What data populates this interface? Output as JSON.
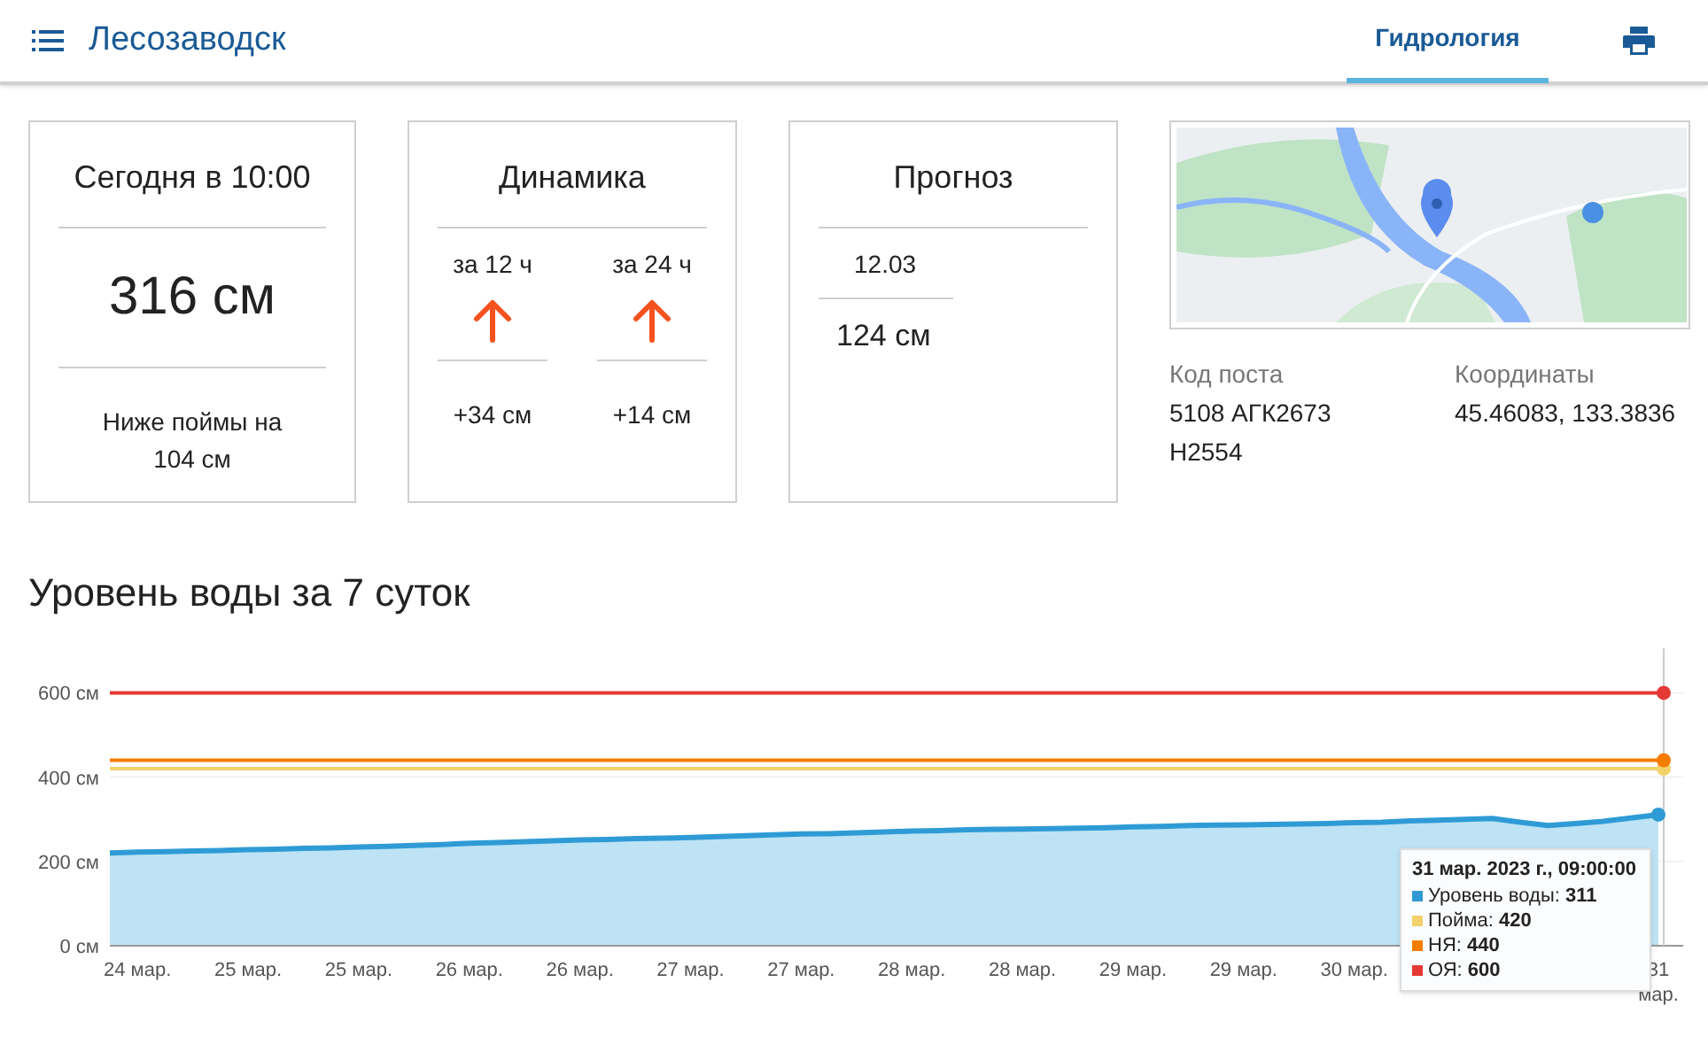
{
  "header": {
    "title": "Лесозаводск",
    "tabs": [
      {
        "label": "Гидрология",
        "selected": true
      }
    ]
  },
  "cards": [
    {
      "kind": "current",
      "title": "Сегодня в 10:00",
      "value": "316 см",
      "note": "Ниже поймы на 104 см"
    },
    {
      "kind": "dynamics",
      "title": "Динамика",
      "columns": [
        {
          "period": "за 12 ч",
          "rising": true,
          "change": "+34 см"
        },
        {
          "period": "за 24 ч",
          "rising": true,
          "change": "+14 см"
        }
      ]
    },
    {
      "kind": "forecast",
      "title": "Прогноз",
      "date": "12.03",
      "value": "124 см"
    }
  ],
  "post": {
    "code_label": "Код поста",
    "code_value": "5108 АГК2673 Н2554",
    "coords_label": "Координаты",
    "coords_value": "45.46083, 133.3836"
  },
  "chart_title": "Уровень воды за 7 суток",
  "chart": {
    "chart_data": {
      "type": "area",
      "categories": [
        null,
        "24 мар.",
        null,
        null,
        null,
        "25 мар.",
        null,
        null,
        null,
        "25 мар.",
        null,
        null,
        null,
        "26 мар.",
        null,
        null,
        null,
        "26 мар.",
        null,
        null,
        null,
        "27 мар.",
        null,
        null,
        null,
        "27 мар.",
        null,
        null,
        null,
        "28 мар.",
        null,
        null,
        null,
        "28 мар.",
        null,
        null,
        null,
        "29 мар.",
        null,
        null,
        null,
        "29 мар.",
        null,
        null,
        null,
        "30 мар.",
        null,
        null,
        null,
        null,
        null,
        null,
        null,
        null,
        null,
        null,
        "31 мар."
      ],
      "series": [
        {
          "color": "#2f9bd6",
          "values": [
            220,
            222,
            223,
            225,
            226,
            228,
            229,
            231,
            232,
            234,
            236,
            238,
            240,
            243,
            245,
            247,
            249,
            251,
            252,
            254,
            255,
            257,
            259,
            261,
            263,
            265,
            266,
            268,
            270,
            272,
            273,
            275,
            276,
            277,
            278,
            279,
            280,
            282,
            283,
            285,
            286,
            287,
            288,
            289,
            290,
            292,
            293,
            296,
            298,
            300,
            302,
            293,
            285,
            290,
            295,
            303,
            311
          ]
        },
        {
          "type": "line",
          "color": "#f2d16b",
          "values": [
            420,
            420,
            420,
            420,
            420,
            420,
            420,
            420,
            420,
            420,
            420,
            420,
            420,
            420,
            420,
            420,
            420,
            420,
            420,
            420,
            420,
            420,
            420,
            420,
            420,
            420,
            420,
            420,
            420,
            420,
            420,
            420,
            420,
            420,
            420,
            420,
            420,
            420,
            420,
            420,
            420,
            420,
            420,
            420,
            420,
            420,
            420,
            420,
            420,
            420,
            420,
            420,
            420,
            420,
            420,
            420,
            420
          ]
        },
        {
          "type": "line",
          "color": "#f57c00",
          "values": [
            440,
            440,
            440,
            440,
            440,
            440,
            440,
            440,
            440,
            440,
            440,
            440,
            440,
            440,
            440,
            440,
            440,
            440,
            440,
            440,
            440,
            440,
            440,
            440,
            440,
            440,
            440,
            440,
            440,
            440,
            440,
            440,
            440,
            440,
            440,
            440,
            440,
            440,
            440,
            440,
            440,
            440,
            440,
            440,
            440,
            440,
            440,
            440,
            440,
            440,
            440,
            440,
            440,
            440,
            440,
            440,
            440
          ]
        },
        {
          "type": "line",
          "color": "#e53935",
          "values": [
            600,
            600,
            600,
            600,
            600,
            600,
            600,
            600,
            600,
            600,
            600,
            600,
            600,
            600,
            600,
            600,
            600,
            600,
            600,
            600,
            600,
            600,
            600,
            600,
            600,
            600,
            600,
            600,
            600,
            600,
            600,
            600,
            600,
            600,
            600,
            600,
            600,
            600,
            600,
            600,
            600,
            600,
            600,
            600,
            600,
            600,
            600,
            600,
            600,
            600,
            600,
            600,
            600,
            600,
            600,
            600,
            600
          ]
        }
      ],
      "ylim": [
        0,
        700
      ],
      "yticks": [
        {
          "value": 0,
          "label": "0 см"
        },
        {
          "value": 200,
          "label": "200 см"
        },
        {
          "value": 400,
          "label": "400 см"
        },
        {
          "value": 600,
          "label": "600 см"
        }
      ],
      "grid": true
    },
    "tooltip": {
      "title": "31 мар. 2023 г., 09:00:00",
      "items": [
        {
          "label": "Уровень воды:",
          "value": "311",
          "color": "#2f9bd6"
        },
        {
          "label": "Пойма:",
          "value": "420",
          "color": "#f2d16b"
        },
        {
          "label": "НЯ:",
          "value": "440",
          "color": "#f57c00"
        },
        {
          "label": "ОЯ:",
          "value": "600",
          "color": "#e53935"
        }
      ]
    }
  }
}
